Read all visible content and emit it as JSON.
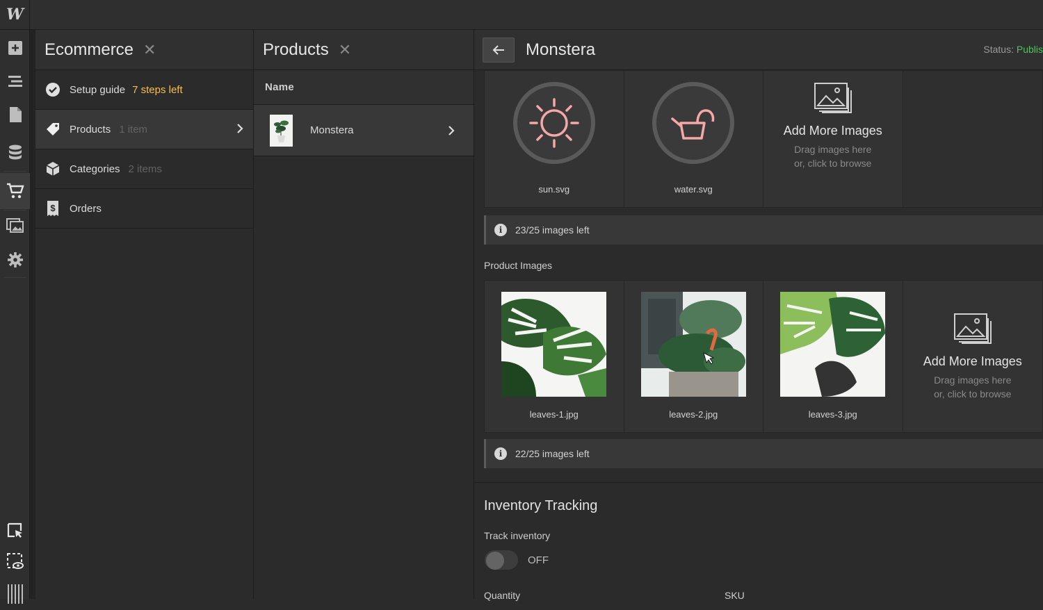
{
  "rail": {
    "logo": "W",
    "icons": [
      "add-icon",
      "navigator-icon",
      "pages-icon",
      "cms-icon",
      "ecommerce-cart-icon",
      "assets-icon",
      "settings-icon"
    ],
    "bottom_icons": [
      "select-icon",
      "preview-icon",
      "audit-icon"
    ]
  },
  "ecommerce_panel": {
    "title": "Ecommerce",
    "items": [
      {
        "label": "Setup guide",
        "warn": "7 steps left"
      },
      {
        "label": "Products",
        "sub": "1 item"
      },
      {
        "label": "Categories",
        "sub": "2 items"
      },
      {
        "label": "Orders"
      }
    ]
  },
  "products_panel": {
    "title": "Products",
    "column": "Name",
    "rows": [
      {
        "name": "Monstera"
      }
    ]
  },
  "detail": {
    "title": "Monstera",
    "status_label": "Status:",
    "status_value": "Publis",
    "icon_images": [
      {
        "caption": "sun.svg"
      },
      {
        "caption": "water.svg"
      }
    ],
    "add_more": {
      "title": "Add More Images",
      "line1": "Drag images here",
      "line2": "or, click to browse"
    },
    "icons_left": "23/25 images left",
    "product_images_label": "Product Images",
    "product_images": [
      {
        "caption": "leaves-1.jpg"
      },
      {
        "caption": "leaves-2.jpg"
      },
      {
        "caption": "leaves-3.jpg"
      }
    ],
    "product_images_left": "22/25 images left",
    "inventory_title": "Inventory Tracking",
    "track_label": "Track inventory",
    "track_value": "OFF",
    "quantity_label": "Quantity",
    "sku_label": "SKU"
  },
  "colors": {
    "accent_warn": "#f6c04d",
    "status_green": "#4cc45a",
    "sun_pink": "#f4a8a8"
  }
}
